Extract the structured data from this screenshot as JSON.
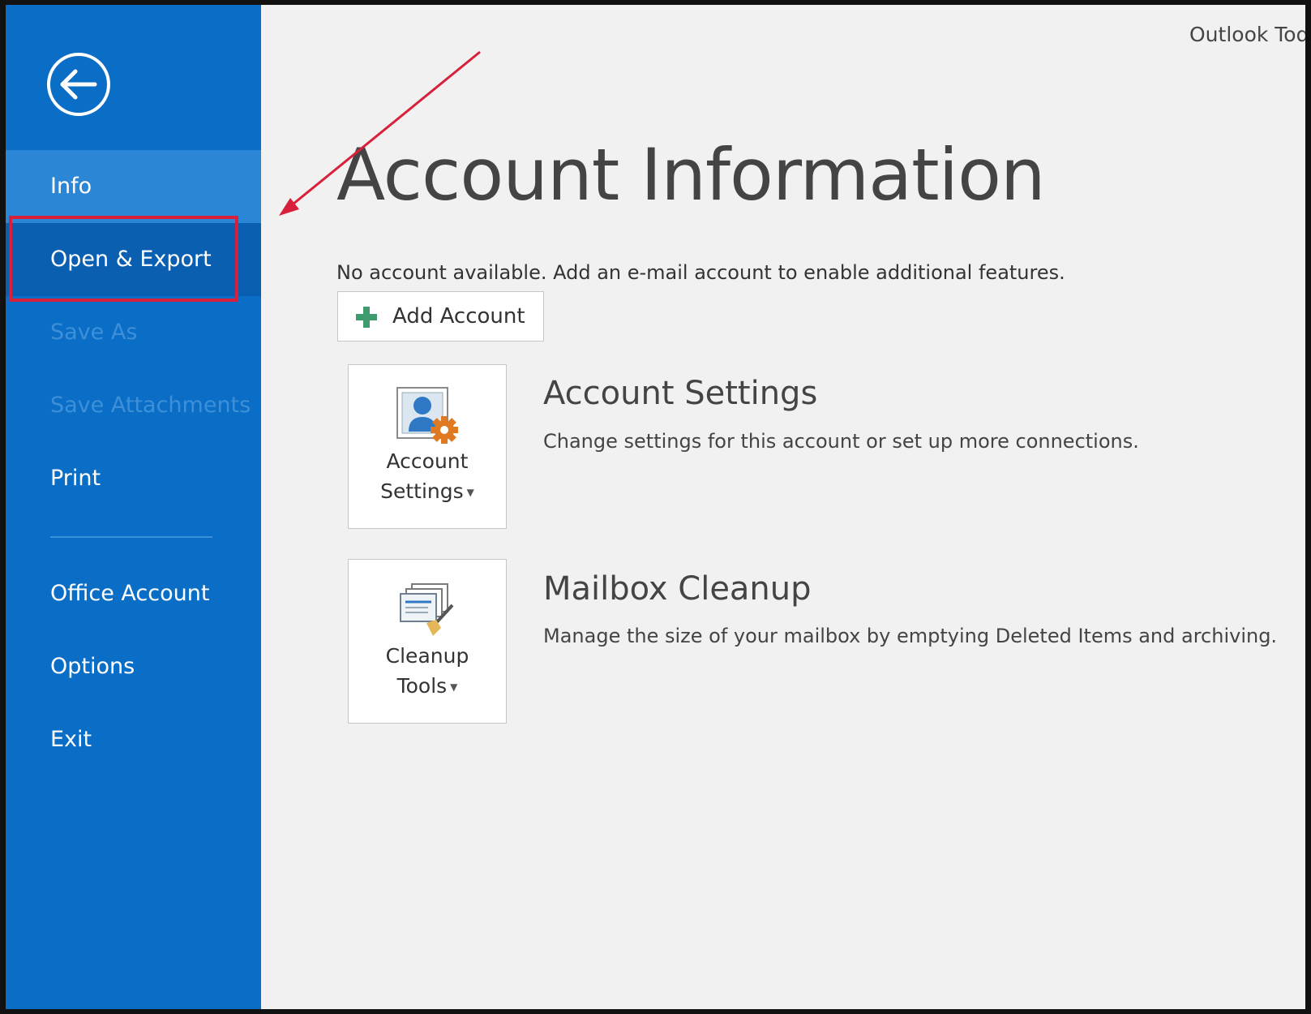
{
  "window": {
    "title": "Outlook Today"
  },
  "sidebar": {
    "back_icon": "back-arrow-circle-icon",
    "items": [
      {
        "label": "Info",
        "state": "selected"
      },
      {
        "label": "Open & Export",
        "state": "highlighted"
      },
      {
        "label": "Save As",
        "state": "disabled"
      },
      {
        "label": "Save Attachments",
        "state": "disabled"
      },
      {
        "label": "Print",
        "state": "normal"
      },
      {
        "label": "Office Account",
        "state": "normal"
      },
      {
        "label": "Options",
        "state": "normal"
      },
      {
        "label": "Exit",
        "state": "normal"
      }
    ]
  },
  "main": {
    "title": "Account Information",
    "no_account_message": "No account available. Add an e-mail account to enable additional features.",
    "add_account": {
      "label": "Add Account",
      "icon": "plus-icon"
    },
    "sections": [
      {
        "button_line1": "Account",
        "button_line2": "Settings",
        "icon": "account-settings-icon",
        "heading": "Account Settings",
        "description": "Change settings for this account or set up more connections."
      },
      {
        "button_line1": "Cleanup",
        "button_line2": "Tools",
        "icon": "cleanup-tools-icon",
        "heading": "Mailbox Cleanup",
        "description": "Manage the size of your mailbox by emptying Deleted Items and archiving."
      }
    ]
  },
  "colors": {
    "sidebar_bg": "#0a6ec6",
    "selected_item_bg": "#2b87d6",
    "annotation_red": "#d8203a",
    "content_bg": "#f1f1f1"
  }
}
